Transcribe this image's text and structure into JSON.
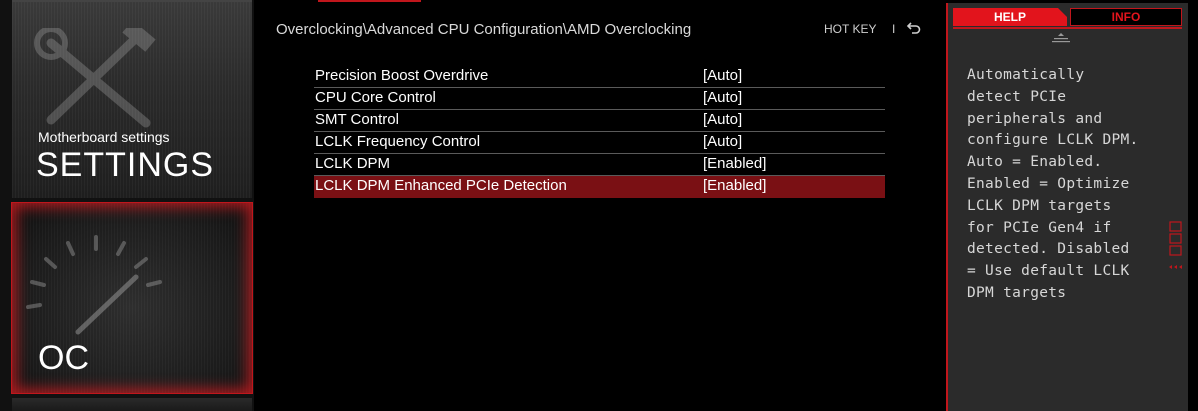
{
  "left_panel": {
    "settings_subtitle": "Motherboard settings",
    "settings_title": "SETTINGS",
    "oc_title": "OC"
  },
  "header": {
    "breadcrumb": "Overclocking\\Advanced CPU Configuration\\AMD Overclocking",
    "hotkey_label": "HOT KEY",
    "separator": "I",
    "back_icon": "back-arrow-icon"
  },
  "menu": {
    "items": [
      {
        "label": "Precision Boost Overdrive",
        "value": "[Auto]",
        "selected": false
      },
      {
        "label": "CPU Core Control",
        "value": "[Auto]",
        "selected": false
      },
      {
        "label": "SMT Control",
        "value": "[Auto]",
        "selected": false
      },
      {
        "label": "LCLK Frequency Control",
        "value": "[Auto]",
        "selected": false
      },
      {
        "label": "LCLK DPM",
        "value": "[Enabled]",
        "selected": false
      },
      {
        "label": "LCLK DPM Enhanced PCIe Detection",
        "value": "[Enabled]",
        "selected": true
      }
    ]
  },
  "help_panel": {
    "help_tab": "HELP",
    "info_tab": "INFO",
    "text": "Automatically\ndetect PCIe\nperipherals and\nconfigure LCLK DPM.\nAuto = Enabled.\nEnabled = Optimize\nLCLK DPM targets\nfor PCIe Gen4 if\ndetected. Disabled\n= Use default LCLK\nDPM targets"
  },
  "colors": {
    "accent_red": "#e2141c",
    "selected_row": "#7a1014",
    "panel_bg": "#2b2b2b"
  }
}
